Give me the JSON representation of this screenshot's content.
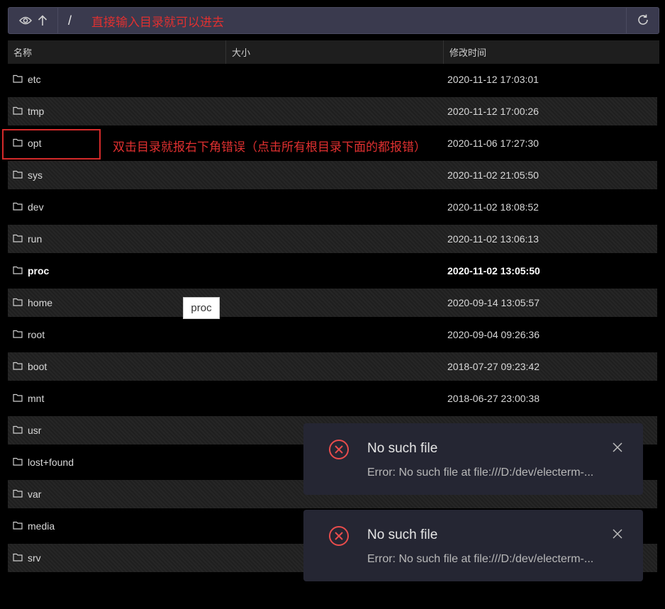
{
  "toolbar": {
    "path": "/",
    "note": "直接输入目录就可以进去",
    "icons": [
      "eye-icon",
      "arrow-up-icon",
      "refresh-icon"
    ]
  },
  "columns": [
    "名称",
    "大小",
    "修改时间"
  ],
  "files": [
    {
      "name": "etc",
      "size": "",
      "modified": "2020-11-12 17:03:01"
    },
    {
      "name": "tmp",
      "size": "",
      "modified": "2020-11-12 17:00:26"
    },
    {
      "name": "opt",
      "size": "",
      "modified": "2020-11-06 17:27:30"
    },
    {
      "name": "sys",
      "size": "",
      "modified": "2020-11-02 21:05:50"
    },
    {
      "name": "dev",
      "size": "",
      "modified": "2020-11-02 18:08:52"
    },
    {
      "name": "run",
      "size": "",
      "modified": "2020-11-02 13:06:13"
    },
    {
      "name": "proc",
      "size": "",
      "modified": "2020-11-02 13:05:50"
    },
    {
      "name": "home",
      "size": "",
      "modified": "2020-09-14 13:05:57"
    },
    {
      "name": "root",
      "size": "",
      "modified": "2020-09-04 09:26:36"
    },
    {
      "name": "boot",
      "size": "",
      "modified": "2018-07-27 09:23:42"
    },
    {
      "name": "mnt",
      "size": "",
      "modified": "2018-06-27 23:00:38"
    },
    {
      "name": "usr",
      "size": "",
      "modified": ""
    },
    {
      "name": "lost+found",
      "size": "",
      "modified": ""
    },
    {
      "name": "var",
      "size": "",
      "modified": ""
    },
    {
      "name": "media",
      "size": "",
      "modified": ""
    },
    {
      "name": "srv",
      "size": "",
      "modified": ""
    }
  ],
  "annotation": {
    "opt_note": "双击目录就报右下角错误（点击所有根目录下面的都报错）"
  },
  "tooltip": "proc",
  "toasts": [
    {
      "title": "No such file",
      "message": "Error: No such file at file:///D:/dev/electerm-..."
    },
    {
      "title": "No such file",
      "message": "Error: No such file at file:///D:/dev/electerm-..."
    }
  ],
  "colors": {
    "error": "#e03030",
    "toolbar_bg": "#3a3a4e",
    "toast_bg": "#252633",
    "toast_icon": "#e84c4c"
  }
}
